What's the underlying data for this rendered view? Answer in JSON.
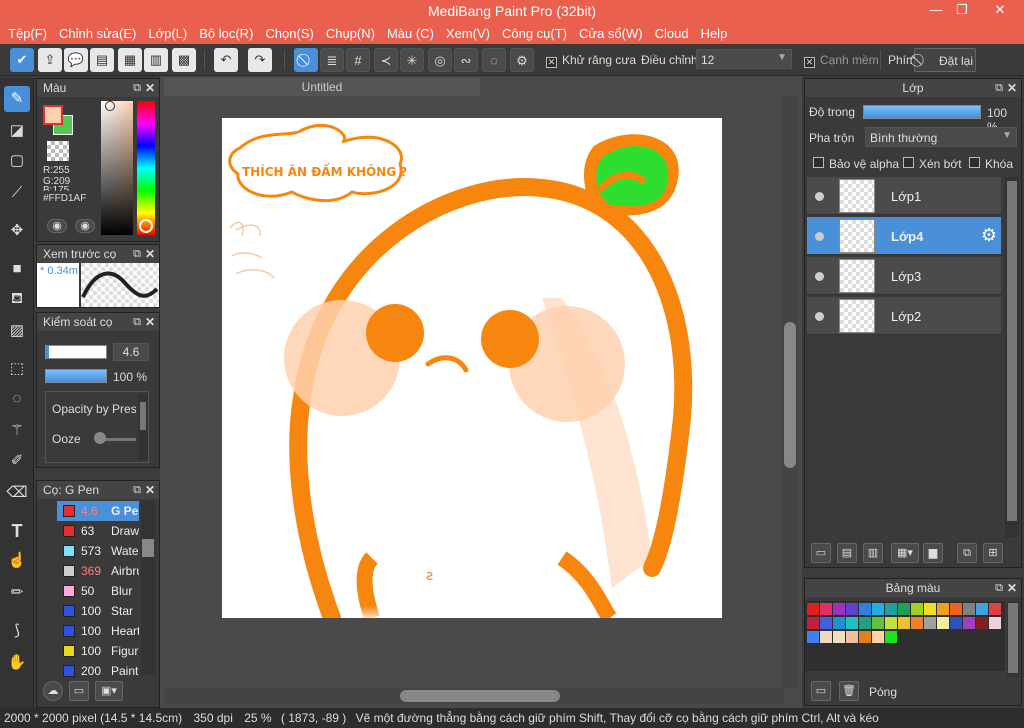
{
  "window": {
    "title": "MediBang Paint Pro (32bit)",
    "minimize": "—",
    "restore": "❐",
    "close": "✕"
  },
  "menu": [
    "Tệp(F)",
    "Chỉnh sửa(E)",
    "Lớp(L)",
    "Bộ lọc(R)",
    "Chọn(S)",
    "Chụp(N)",
    "Màu (C)",
    "Xem(V)",
    "Công cụ(T)",
    "Cửa sổ(W)",
    "Cloud",
    "Help"
  ],
  "toolbar": {
    "antialias_label": "Khử răng cưa",
    "adjust_label": "Điều chỉnh",
    "adjust_value": "12",
    "soft_edge_label": "Cạnh mềm",
    "key_label": "Phím",
    "reset_label": "Đặt lại"
  },
  "color_panel": {
    "title": "Màu",
    "r": "R:255",
    "g": "G:209",
    "b": "B:175",
    "hex": "#FFD1AF",
    "fg": "#ffd1af",
    "bg": "#4fc94f"
  },
  "brush_preview": {
    "title": "Xem trước cọ",
    "size": "* 0.34m"
  },
  "brush_control": {
    "title": "Kiểm soát cọ",
    "size": "4.6",
    "opacity": "100 %",
    "opt1": "Opacity by Pressure",
    "opt2": "Ooze"
  },
  "brush_list": {
    "title": "Cọ: G Pen",
    "items": [
      {
        "size": "4.6",
        "name": "G Pen",
        "color": "#e03030",
        "size_color": "#ff8080",
        "selected": true
      },
      {
        "size": "63",
        "name": "Drawing",
        "color": "#e03030",
        "size_color": "#eeeeee"
      },
      {
        "size": "573",
        "name": "Watercolor",
        "color": "#7fdfff",
        "size_color": "#eeeeee"
      },
      {
        "size": "369",
        "name": "Airbrush",
        "color": "#cccccc",
        "size_color": "#ff8080"
      },
      {
        "size": "50",
        "name": "Blur",
        "color": "#ffaadd",
        "size_color": "#eeeeee"
      },
      {
        "size": "100",
        "name": "Star",
        "color": "#3050e0",
        "size_color": "#eeeeee"
      },
      {
        "size": "100",
        "name": "Heart",
        "color": "#3050e0",
        "size_color": "#eeeeee"
      },
      {
        "size": "100",
        "name": "Figure",
        "color": "#e8d820",
        "size_color": "#eeeeee"
      },
      {
        "size": "200",
        "name": "Paint",
        "color": "#3050e0",
        "size_color": "#eeeeee"
      }
    ]
  },
  "document": {
    "tab": "Untitled",
    "speech": "THÍCH ĂN ĐẤM KHÔNG ?",
    "mark": "ꙅ"
  },
  "layer_panel": {
    "title": "Lớp",
    "opacity_label": "Độ trong",
    "opacity_value": "100 %",
    "opacity": 1.0,
    "blend_label": "Pha trộn",
    "blend_value": "Bình thường",
    "protect_alpha": "Bảo vệ alpha",
    "clip": "Xén bớt",
    "lock": "Khóa",
    "layers": [
      {
        "name": "Lớp1",
        "selected": false
      },
      {
        "name": "Lớp4",
        "selected": true
      },
      {
        "name": "Lớp3",
        "selected": false
      },
      {
        "name": "Lớp2",
        "selected": false
      }
    ]
  },
  "palette_panel": {
    "title": "Bảng màu",
    "close_label": "Póng",
    "colors": [
      "#e02020",
      "#e03060",
      "#a030c0",
      "#6040d0",
      "#3080e0",
      "#20b0e0",
      "#20a0a0",
      "#20a050",
      "#a0d020",
      "#f0e020",
      "#f0a020",
      "#f06020",
      "#808080",
      "#40a0e0",
      "#e04040",
      "#c02040",
      "#4060e0",
      "#2090d0",
      "#20c0c0",
      "#20a080",
      "#60c040",
      "#c0e040",
      "#f0c030",
      "#f08030",
      "#a0a0a0",
      "#f0f0a0",
      "#3050c0",
      "#a040c0",
      "#802020",
      "#f0d0e0",
      "#4080f0",
      "#f0d8c0",
      "#f0e0c0",
      "#f0c0a0",
      "#e08020",
      "#ffd1af",
      "#20e020"
    ]
  },
  "status": {
    "pixels": "2000 * 2000 pixel",
    "size_cm": "(14.5 * 14.5cm)",
    "dpi": "350 dpi",
    "zoom": "25 %",
    "coords": "( 1873, -89 )",
    "hint": "Vẽ một đường thẳng bằng cách giữ phím Shift, Thay đổi cỡ cọ bằng cách giữ phím Ctrl, Alt và kéo"
  }
}
